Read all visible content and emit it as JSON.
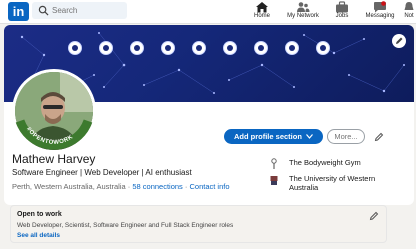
{
  "topbar": {
    "logo_text": "in",
    "search": {
      "placeholder": "Search"
    },
    "nav": [
      {
        "label": "Home",
        "icon": "home-icon"
      },
      {
        "label": "My Network",
        "icon": "network-icon"
      },
      {
        "label": "Jobs",
        "icon": "jobs-icon"
      },
      {
        "label": "Messaging",
        "icon": "messaging-icon"
      },
      {
        "label": "Not",
        "icon": "notifications-icon"
      }
    ]
  },
  "profile": {
    "banner_icons": [
      "tool-icon",
      "shield-icon",
      "cube-icon",
      "slides-icon",
      "code-icon",
      "github-icon",
      "linkedin-icon",
      "share-icon",
      "grid-icon"
    ],
    "avatar_ribbon_text": "#OPENTOWORK",
    "name": "Mathew Harvey",
    "headline": "Software Engineer | Web Developer | AI enthusiast",
    "location": "Perth, Western Australia, Australia",
    "separator": "·",
    "connections": "58 connections",
    "contact": "Contact info",
    "add_section_label": "Add profile section",
    "more_label": "More...",
    "experience": [
      {
        "name": "The Bodyweight Gym",
        "icon": "gym-icon"
      },
      {
        "name": "The University of Western Australia",
        "icon": "university-icon"
      }
    ]
  },
  "open_to_work": {
    "title": "Open to work",
    "roles": "Web Developer, Scientist, Software Engineer and Full Stack Engineer roles",
    "link": "See all details"
  },
  "colors": {
    "accent": "#0a66c2",
    "banner": "#1c2c86"
  }
}
